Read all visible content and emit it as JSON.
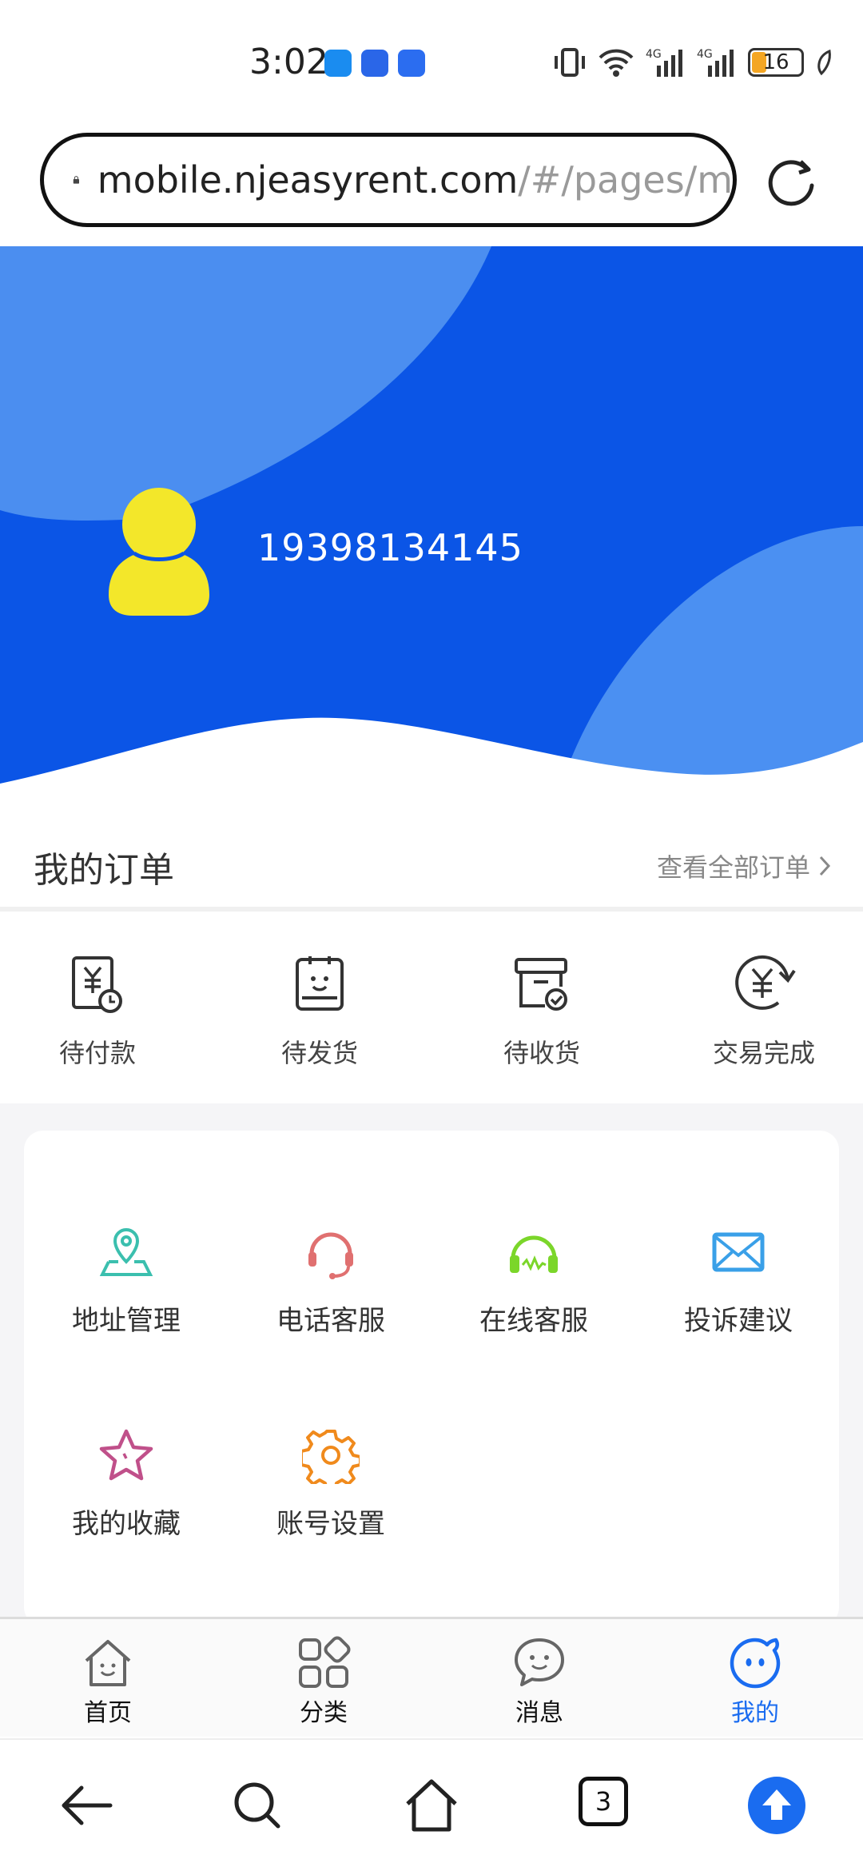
{
  "status": {
    "time": "3:02",
    "battery": "16"
  },
  "browser": {
    "url_main": "mobile.njeasyrent.com",
    "url_rest": "/#/pages/m",
    "tab_count": "3"
  },
  "profile": {
    "phone": "19398134145"
  },
  "orders": {
    "title": "我的订单",
    "view_all": "查看全部订单",
    "items": [
      {
        "label": "待付款",
        "icon": "pending-payment-icon"
      },
      {
        "label": "待发货",
        "icon": "pending-shipment-icon"
      },
      {
        "label": "待收货",
        "icon": "pending-receipt-icon"
      },
      {
        "label": "交易完成",
        "icon": "completed-icon"
      }
    ]
  },
  "services": [
    {
      "label": "地址管理",
      "icon": "location-icon",
      "color": "#3bbfae"
    },
    {
      "label": "电话客服",
      "icon": "headset-icon",
      "color": "#e07070"
    },
    {
      "label": "在线客服",
      "icon": "headphones-icon",
      "color": "#7bd62a"
    },
    {
      "label": "投诉建议",
      "icon": "mail-icon",
      "color": "#3aa0e8"
    },
    {
      "label": "我的收藏",
      "icon": "star-icon",
      "color": "#c0508a"
    },
    {
      "label": "账号设置",
      "icon": "gear-icon",
      "color": "#f08a1c"
    }
  ],
  "tabbar": [
    {
      "label": "首页",
      "icon": "home-icon"
    },
    {
      "label": "分类",
      "icon": "category-icon"
    },
    {
      "label": "消息",
      "icon": "message-icon"
    },
    {
      "label": "我的",
      "icon": "profile-icon",
      "active": true
    }
  ],
  "colors": {
    "primary": "#0b55e6",
    "accent": "#1a6cf0",
    "avatar": "#f3e72a"
  }
}
